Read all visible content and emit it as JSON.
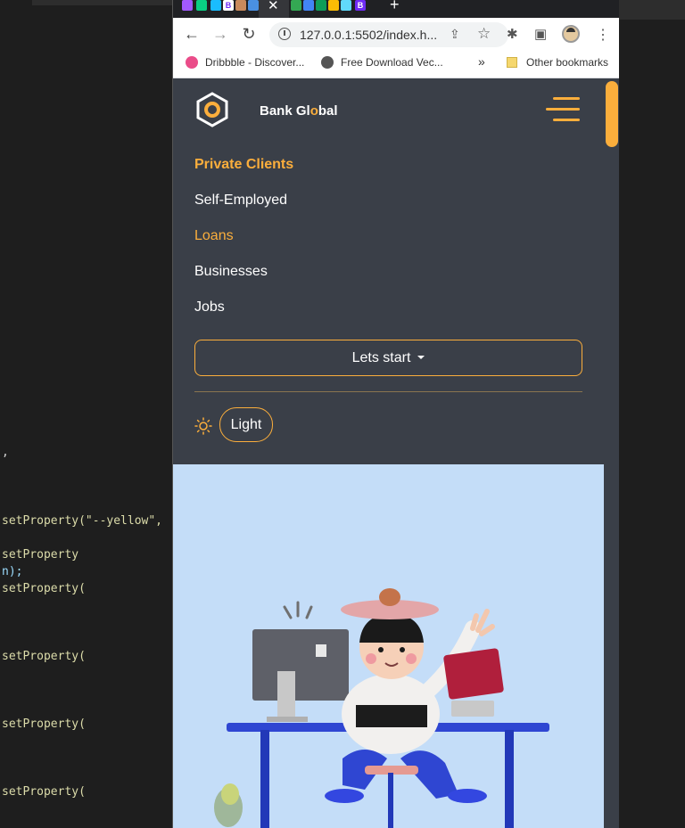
{
  "editor": {
    "lines": [
      {
        "code": ","
      },
      {
        "code": "setProperty(\"--yellow\","
      },
      {
        "code": "setProperty"
      },
      {
        "code": "n);"
      },
      {
        "code": "setProperty("
      },
      {
        "code": "setProperty("
      },
      {
        "code": "setProperty("
      },
      {
        "code": "setProperty("
      }
    ]
  },
  "browser": {
    "tabs": {
      "new_tab_label": "+",
      "close_label": "✕"
    },
    "toolbar": {
      "back": "←",
      "forward": "→",
      "reload": "↻",
      "url": "127.0.0.1:5502/index.h...",
      "share": "⇪",
      "bookmark_star": "☆",
      "extensions": "✱",
      "sidepanel": "▣",
      "menu": "⋮"
    },
    "bookmarks": {
      "items": [
        {
          "label": "Dribbble - Discover...",
          "icon": "dribbble-icon"
        },
        {
          "label": "Free Download Vec...",
          "icon": "globe-icon"
        }
      ],
      "more": "»",
      "other": "Other bookmarks"
    }
  },
  "site": {
    "brand_prefix": "Bank Gl",
    "brand_o": "o",
    "brand_suffix": "bal",
    "nav": [
      {
        "label": "Private Clients"
      },
      {
        "label": "Self-Employed"
      },
      {
        "label": "Loans"
      },
      {
        "label": "Businesses"
      },
      {
        "label": "Jobs"
      }
    ],
    "cta_label": "Lets start",
    "theme_label": "Light",
    "colors": {
      "accent": "#fbae3c",
      "background": "#3a3f48",
      "hero_bg": "#c4ddf8"
    }
  }
}
